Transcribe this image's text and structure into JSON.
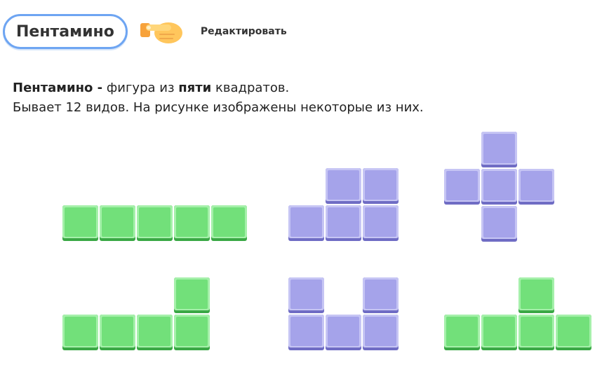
{
  "header": {
    "title": "Пентамино",
    "edit_label": "Редактировать"
  },
  "description": {
    "term": "Пентамино -",
    "text_a": " фигура из ",
    "bold_word": "пяти",
    "text_b": " квадратов.",
    "line2": "Бывает 12 видов. На рисунке изображены некоторые из них."
  },
  "colors": {
    "green": "#72e07a",
    "purple": "#a5a3ea",
    "pill_border": "#6ea5f2"
  },
  "figures": [
    {
      "color": "green",
      "cells": [
        [
          0,
          0
        ],
        [
          1,
          0
        ],
        [
          2,
          0
        ],
        [
          3,
          0
        ],
        [
          4,
          0
        ]
      ]
    },
    {
      "color": "purple",
      "cells": [
        [
          1,
          0
        ],
        [
          2,
          0
        ],
        [
          0,
          1
        ],
        [
          1,
          1
        ],
        [
          2,
          1
        ]
      ]
    },
    {
      "color": "purple",
      "cells": [
        [
          1,
          0
        ],
        [
          0,
          1
        ],
        [
          1,
          1
        ],
        [
          2,
          1
        ],
        [
          1,
          2
        ]
      ]
    },
    {
      "color": "green",
      "cells": [
        [
          3,
          0
        ],
        [
          0,
          1
        ],
        [
          1,
          1
        ],
        [
          2,
          1
        ],
        [
          3,
          1
        ]
      ]
    },
    {
      "color": "purple",
      "cells": [
        [
          0,
          0
        ],
        [
          2,
          0
        ],
        [
          0,
          1
        ],
        [
          1,
          1
        ],
        [
          2,
          1
        ]
      ]
    },
    {
      "color": "green",
      "cells": [
        [
          2,
          0
        ],
        [
          0,
          1
        ],
        [
          1,
          1
        ],
        [
          2,
          1
        ],
        [
          3,
          1
        ]
      ]
    }
  ]
}
